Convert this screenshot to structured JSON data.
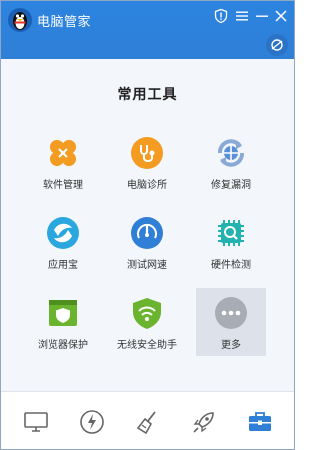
{
  "window": {
    "title": "电脑管家"
  },
  "tools": {
    "heading": "常用工具",
    "items": [
      {
        "label": "软件管理",
        "icon": "software-manager-icon",
        "color": "#f39c21"
      },
      {
        "label": "电脑诊所",
        "icon": "stethoscope-icon",
        "color": "#f39c21"
      },
      {
        "label": "修复漏洞",
        "icon": "repair-vulnerability-icon",
        "color": "#5b8fd8"
      },
      {
        "label": "应用宝",
        "icon": "app-store-icon",
        "color": "#2ba7e0"
      },
      {
        "label": "测试网速",
        "icon": "speed-test-icon",
        "color": "#2f7fd6"
      },
      {
        "label": "硬件检测",
        "icon": "hardware-chip-icon",
        "color": "#22b3b0"
      },
      {
        "label": "浏览器保护",
        "icon": "browser-protect-icon",
        "color": "#6bb42f"
      },
      {
        "label": "无线安全助手",
        "icon": "wifi-security-icon",
        "color": "#6bb42f"
      },
      {
        "label": "更多",
        "icon": "more-icon",
        "color": "#a8adb5"
      }
    ]
  },
  "bottom_nav": {
    "items": [
      {
        "icon": "computer-icon",
        "label": "computer"
      },
      {
        "icon": "lightning-icon",
        "label": "speedup"
      },
      {
        "icon": "broom-icon",
        "label": "cleanup"
      },
      {
        "icon": "rocket-icon",
        "label": "boost"
      },
      {
        "icon": "toolbox-icon",
        "label": "toolbox",
        "active": true
      }
    ],
    "active_color": "#2f7fd6",
    "inactive_color": "#666666"
  }
}
